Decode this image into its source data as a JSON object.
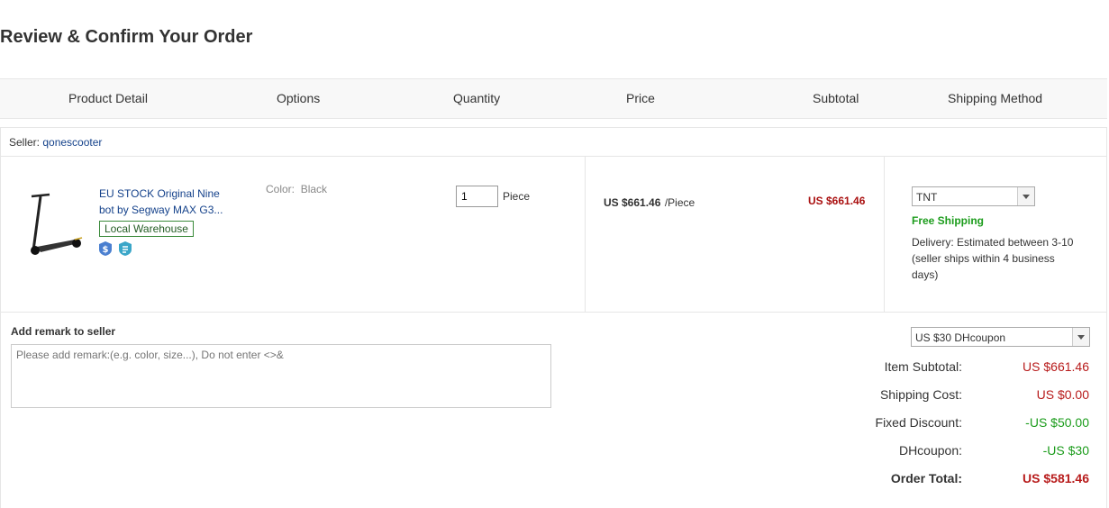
{
  "page_title": "Review & Confirm Your Order",
  "columns": [
    "Product Detail",
    "Options",
    "Quantity",
    "Price",
    "Subtotal",
    "Shipping Method"
  ],
  "seller": {
    "label": "Seller:",
    "name": "qonescooter"
  },
  "item": {
    "name_line1": "EU STOCK Original Nine",
    "name_line2": "bot by Segway MAX G3...",
    "badge": "Local Warehouse",
    "option_label": "Color:",
    "option_value": "Black",
    "quantity": "1",
    "unit": "Piece",
    "price": "US $661.46",
    "price_unit": "/Piece",
    "subtotal": "US $661.46",
    "shipping_method": "TNT",
    "free_shipping": "Free Shipping",
    "delivery_line1": "Delivery: Estimated between 3-10",
    "delivery_line2": "(seller ships within 4 business",
    "delivery_line3": "days)"
  },
  "remark": {
    "label": "Add remark to seller",
    "placeholder": "Please add remark:(e.g. color, size...), Do not enter <>&"
  },
  "coupon_select": "US $30 DHcoupon",
  "summary": {
    "item_subtotal_label": "Item Subtotal:",
    "item_subtotal": "US $661.46",
    "shipping_label": "Shipping Cost:",
    "shipping": "US $0.00",
    "fixed_discount_label": "Fixed Discount:",
    "fixed_discount": "-US $50.00",
    "dhcoupon_label": "DHcoupon:",
    "dhcoupon": "-US $30",
    "order_total_label": "Order Total:",
    "order_total": "US $581.46"
  },
  "colors": {
    "link": "#15428b",
    "price_red": "#b81c1c",
    "discount_green": "#1c9c1c"
  },
  "icons": [
    "scooter-product-image",
    "buyer-protection-icon",
    "return-policy-icon",
    "dropdown-arrow-icon"
  ]
}
